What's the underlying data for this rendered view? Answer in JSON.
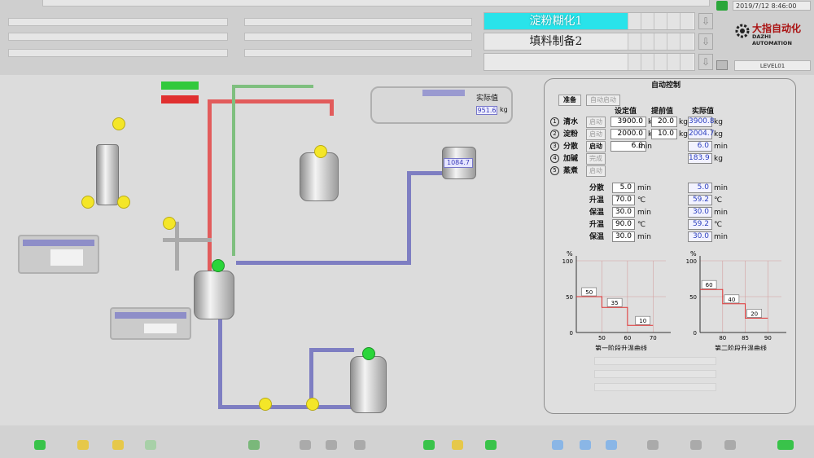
{
  "header": {
    "datetime": "2019/7/12 8:46:00",
    "user": "LEVEL01",
    "recipes": [
      {
        "label": "淀粉糊化1",
        "active": true
      },
      {
        "label": "填料制备2",
        "active": false
      },
      {
        "label": "",
        "active": false
      }
    ]
  },
  "logo": {
    "cn": "大指自动化",
    "en": "DAZHI AUTOMATION"
  },
  "process": {
    "info_box": {
      "header": "实际值",
      "value": "951.6",
      "unit": "kg"
    },
    "tank_value": "1084.7",
    "tank_unit": "kg"
  },
  "auto_control": {
    "title": "自动控制",
    "ready_button": "准备",
    "auto_start_button": "自动启动",
    "col_set": "设定值",
    "col_advance": "提前值",
    "col_actual": "实际值",
    "steps": [
      {
        "num": "1",
        "name": "清水",
        "button": "启动",
        "set": "3900.0",
        "set_unit": "kg",
        "advance": "20.0",
        "advance_unit": "kg",
        "actual": "3900.8",
        "actual_unit": "kg",
        "active": false
      },
      {
        "num": "2",
        "name": "淀粉",
        "button": "启动",
        "set": "2000.0",
        "set_unit": "kg",
        "advance": "10.0",
        "advance_unit": "kg",
        "actual": "2004.7",
        "actual_unit": "kg",
        "active": false
      },
      {
        "num": "3",
        "name": "分散",
        "button": "启动",
        "set": "6.0",
        "set_unit": "min",
        "advance": "",
        "advance_unit": "",
        "actual": "6.0",
        "actual_unit": "min",
        "active": true
      },
      {
        "num": "4",
        "name": "加碱",
        "button": "完成",
        "set": "",
        "set_unit": "",
        "advance": "",
        "advance_unit": "",
        "actual": "183.9",
        "actual_unit": "kg",
        "active": false
      },
      {
        "num": "5",
        "name": "蒸煮",
        "button": "启动",
        "set": "",
        "set_unit": "",
        "advance": "",
        "advance_unit": "",
        "actual": "",
        "actual_unit": "",
        "active": false
      }
    ],
    "params": [
      {
        "name": "分散",
        "set": "5.0",
        "set_unit": "min",
        "actual": "5.0",
        "actual_unit": "min"
      },
      {
        "name": "升温",
        "set": "70.0",
        "set_unit": "℃",
        "actual": "59.2",
        "actual_unit": "℃"
      },
      {
        "name": "保温",
        "set": "30.0",
        "set_unit": "min",
        "actual": "30.0",
        "actual_unit": "min"
      },
      {
        "name": "升温",
        "set": "90.0",
        "set_unit": "℃",
        "actual": "59.2",
        "actual_unit": "℃"
      },
      {
        "name": "保温",
        "set": "30.0",
        "set_unit": "min",
        "actual": "30.0",
        "actual_unit": "min"
      }
    ]
  },
  "chart_data": [
    {
      "type": "line",
      "title": "第一阶段升温曲线",
      "ylabel": "%",
      "yticks": [
        "100",
        "50",
        "0"
      ],
      "xticks": [
        "50",
        "60",
        "70"
      ],
      "xlim": [
        40,
        75
      ],
      "ylim": [
        0,
        100
      ],
      "x": [
        40,
        50,
        50,
        60,
        60,
        70
      ],
      "y": [
        50,
        50,
        35,
        35,
        10,
        10
      ],
      "labels": [
        {
          "x": 45,
          "y": 50,
          "text": "50"
        },
        {
          "x": 55,
          "y": 35,
          "text": "35"
        },
        {
          "x": 66,
          "y": 10,
          "text": "10"
        }
      ]
    },
    {
      "type": "line",
      "title": "第二阶段升温曲线",
      "ylabel": "%",
      "yticks": [
        "100",
        "50",
        "0"
      ],
      "xticks": [
        "80",
        "85",
        "90"
      ],
      "xlim": [
        75,
        93
      ],
      "ylim": [
        0,
        100
      ],
      "x": [
        75,
        80,
        80,
        85,
        85,
        90
      ],
      "y": [
        60,
        60,
        40,
        40,
        20,
        20
      ],
      "labels": [
        {
          "x": 77,
          "y": 60,
          "text": "60"
        },
        {
          "x": 82,
          "y": 40,
          "text": "40"
        },
        {
          "x": 87,
          "y": 20,
          "text": "20"
        }
      ]
    }
  ]
}
